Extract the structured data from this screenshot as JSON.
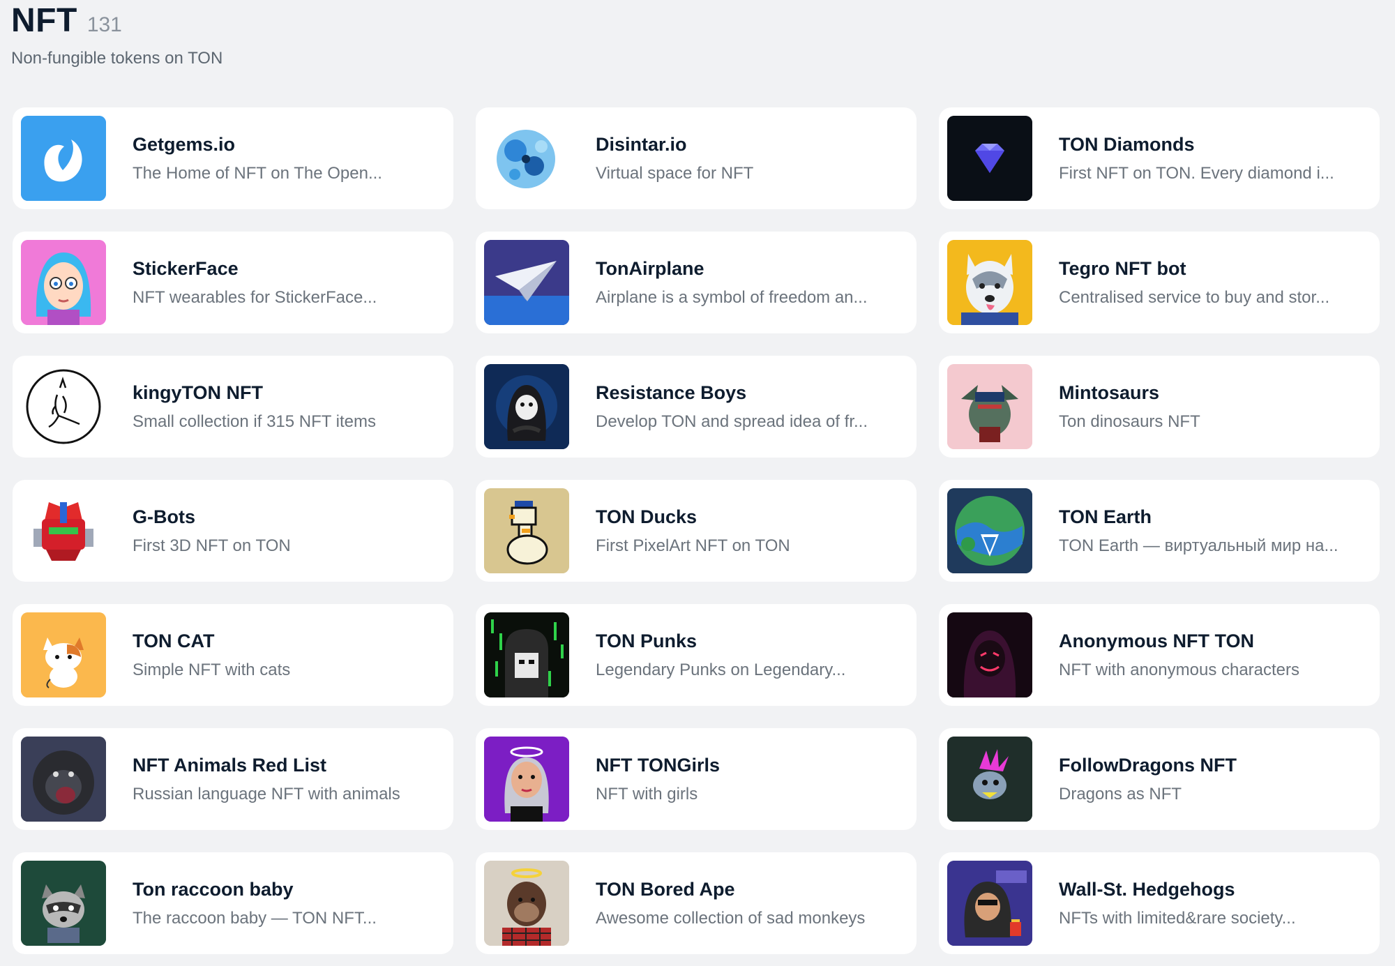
{
  "header": {
    "title": "NFT",
    "count": "131",
    "subtitle": "Non-fungible tokens on TON"
  },
  "cards": [
    {
      "title": "Getgems.io",
      "desc": "The Home of NFT on The Open...",
      "icon": "getgems-logo-icon",
      "bg": "#3aa0ef"
    },
    {
      "title": "Disintar.io",
      "desc": "Virtual space for NFT",
      "icon": "disintar-logo-icon",
      "bg": "#ffffff"
    },
    {
      "title": "TON Diamonds",
      "desc": "First NFT on TON. Every diamond i...",
      "icon": "diamond-icon",
      "bg": "#0a0f16"
    },
    {
      "title": "StickerFace",
      "desc": "NFT wearables for StickerFace...",
      "icon": "stickerface-avatar-icon",
      "bg": "#f07ad8"
    },
    {
      "title": "TonAirplane",
      "desc": "Airplane is a symbol of freedom an...",
      "icon": "paper-airplane-icon",
      "bg": "#3b3a8a"
    },
    {
      "title": "Tegro NFT bot",
      "desc": "Centralised service to buy and stor...",
      "icon": "husky-icon",
      "bg": "#f3b91d"
    },
    {
      "title": "kingyTON NFT",
      "desc": "Small collection if 315 NFT items",
      "icon": "kangaroo-icon",
      "bg": "#ffffff"
    },
    {
      "title": "Resistance Boys",
      "desc": "Develop TON and spread idea of fr...",
      "icon": "hooded-figure-icon",
      "bg": "#0f2a56"
    },
    {
      "title": "Mintosaurs",
      "desc": "Ton dinosaurs NFT",
      "icon": "dinosaur-icon",
      "bg": "#f4c9cf"
    },
    {
      "title": "G-Bots",
      "desc": "First 3D NFT on TON",
      "icon": "robot-head-icon",
      "bg": "#ffffff"
    },
    {
      "title": "TON Ducks",
      "desc": "First PixelArt NFT on TON",
      "icon": "pixel-duck-icon",
      "bg": "#d8c690"
    },
    {
      "title": "TON Earth",
      "desc": "TON Earth — виртуальный мир на...",
      "icon": "earth-globe-icon",
      "bg": "#1f3a5c"
    },
    {
      "title": "TON CAT",
      "desc": "Simple NFT with cats",
      "icon": "cat-icon",
      "bg": "#fbb84d"
    },
    {
      "title": "TON Punks",
      "desc": "Legendary Punks on Legendary...",
      "icon": "pixel-punk-icon",
      "bg": "#0a0f0a"
    },
    {
      "title": "Anonymous NFT TON",
      "desc": "NFT with anonymous characters",
      "icon": "masked-hacker-icon",
      "bg": "#150812"
    },
    {
      "title": "NFT Animals Red List",
      "desc": "Russian language NFT with animals",
      "icon": "gorilla-icon",
      "bg": "#3a3f58"
    },
    {
      "title": "NFT TONGirls",
      "desc": "NFT with girls",
      "icon": "girl-avatar-icon",
      "bg": "#7c1ec4"
    },
    {
      "title": "FollowDragons NFT",
      "desc": "Dragons as NFT",
      "icon": "dragon-icon",
      "bg": "#1f2e2a"
    },
    {
      "title": "Ton raccoon baby",
      "desc": "The raccoon baby — TON NFT...",
      "icon": "raccoon-icon",
      "bg": "#1e4a3a"
    },
    {
      "title": "TON Bored Ape",
      "desc": "Awesome collection of sad monkeys",
      "icon": "bored-ape-icon",
      "bg": "#d8d0c4"
    },
    {
      "title": "Wall-St. Hedgehogs",
      "desc": "NFTs with limited&rare society...",
      "icon": "hedgehog-icon",
      "bg": "#3a3490"
    }
  ]
}
